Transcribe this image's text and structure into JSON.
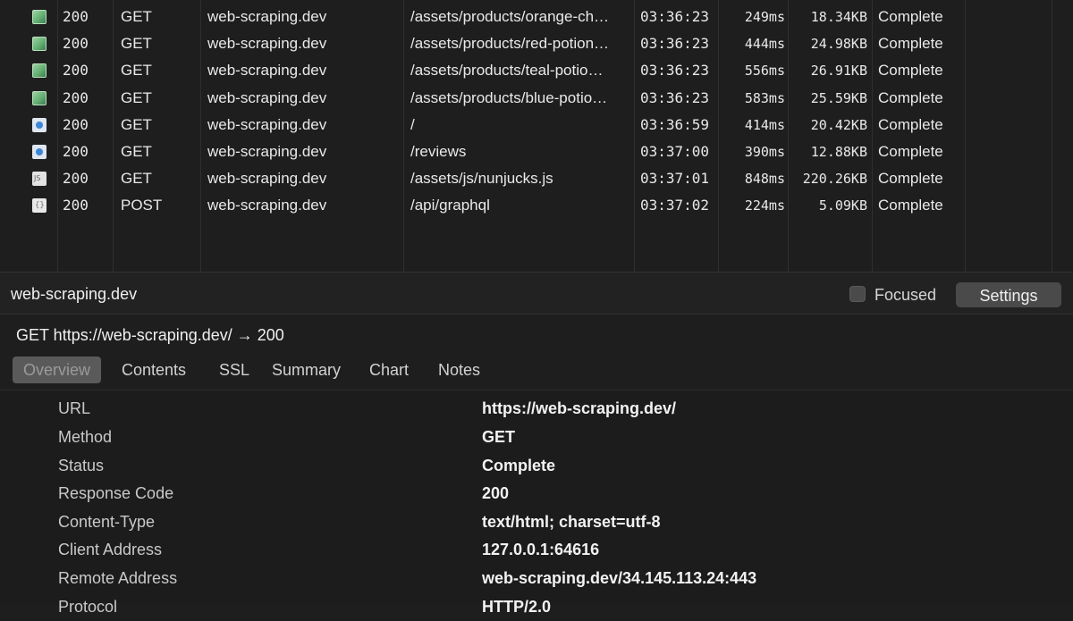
{
  "requests": [
    {
      "type": "image",
      "icon": "image-file-icon",
      "status": "200",
      "method": "GET",
      "host": "web-scraping.dev",
      "path": "/assets/products/orange-ch…",
      "time": "03:36:23",
      "duration": "249ms",
      "size": "18.34KB",
      "state": "Complete"
    },
    {
      "type": "image",
      "icon": "image-file-icon",
      "status": "200",
      "method": "GET",
      "host": "web-scraping.dev",
      "path": "/assets/products/red-potion…",
      "time": "03:36:23",
      "duration": "444ms",
      "size": "24.98KB",
      "state": "Complete"
    },
    {
      "type": "image",
      "icon": "image-file-icon",
      "status": "200",
      "method": "GET",
      "host": "web-scraping.dev",
      "path": "/assets/products/teal-potio…",
      "time": "03:36:23",
      "duration": "556ms",
      "size": "26.91KB",
      "state": "Complete"
    },
    {
      "type": "image",
      "icon": "image-file-icon",
      "status": "200",
      "method": "GET",
      "host": "web-scraping.dev",
      "path": "/assets/products/blue-potio…",
      "time": "03:36:23",
      "duration": "583ms",
      "size": "25.59KB",
      "state": "Complete"
    },
    {
      "type": "doc",
      "icon": "html-document-icon",
      "status": "200",
      "method": "GET",
      "host": "web-scraping.dev",
      "path": "/",
      "time": "03:36:59",
      "duration": "414ms",
      "size": "20.42KB",
      "state": "Complete"
    },
    {
      "type": "doc",
      "icon": "html-document-icon",
      "status": "200",
      "method": "GET",
      "host": "web-scraping.dev",
      "path": "/reviews",
      "time": "03:37:00",
      "duration": "390ms",
      "size": "12.88KB",
      "state": "Complete"
    },
    {
      "type": "script",
      "icon": "javascript-file-icon",
      "status": "200",
      "method": "GET",
      "host": "web-scraping.dev",
      "path": "/assets/js/nunjucks.js",
      "time": "03:37:01",
      "duration": "848ms",
      "size": "220.26KB",
      "state": "Complete"
    },
    {
      "type": "data",
      "icon": "json-file-icon",
      "status": "200",
      "method": "POST",
      "host": "web-scraping.dev",
      "path": "/api/graphql",
      "time": "03:37:02",
      "duration": "224ms",
      "size": "5.09KB",
      "state": "Complete"
    }
  ],
  "host_bar": {
    "title": "web-scraping.dev",
    "focused_label": "Focused",
    "focused_checked": false,
    "settings_label": "Settings"
  },
  "detail": {
    "summary": "GET https://web-scraping.dev/  → 200",
    "tabs": [
      {
        "label": "Overview",
        "active": true
      },
      {
        "label": "Contents",
        "active": false
      },
      {
        "label": "SSL",
        "active": false
      },
      {
        "label": "Summary",
        "active": false
      },
      {
        "label": "Chart",
        "active": false
      },
      {
        "label": "Notes",
        "active": false
      }
    ],
    "overview": [
      {
        "key": "URL",
        "value": "https://web-scraping.dev/"
      },
      {
        "key": "Method",
        "value": "GET"
      },
      {
        "key": "Status",
        "value": "Complete"
      },
      {
        "key": "Response Code",
        "value": "200"
      },
      {
        "key": "Content-Type",
        "value": "text/html; charset=utf-8"
      },
      {
        "key": "Client Address",
        "value": "127.0.0.1:64616"
      },
      {
        "key": "Remote Address",
        "value": "web-scraping.dev/34.145.113.24:443"
      },
      {
        "key": "Protocol",
        "value": "HTTP/2.0"
      }
    ]
  },
  "colors": {
    "background": "#1e1e1e",
    "active_tab": "#5a5a5a",
    "settings_button": "#4a4a4a"
  }
}
